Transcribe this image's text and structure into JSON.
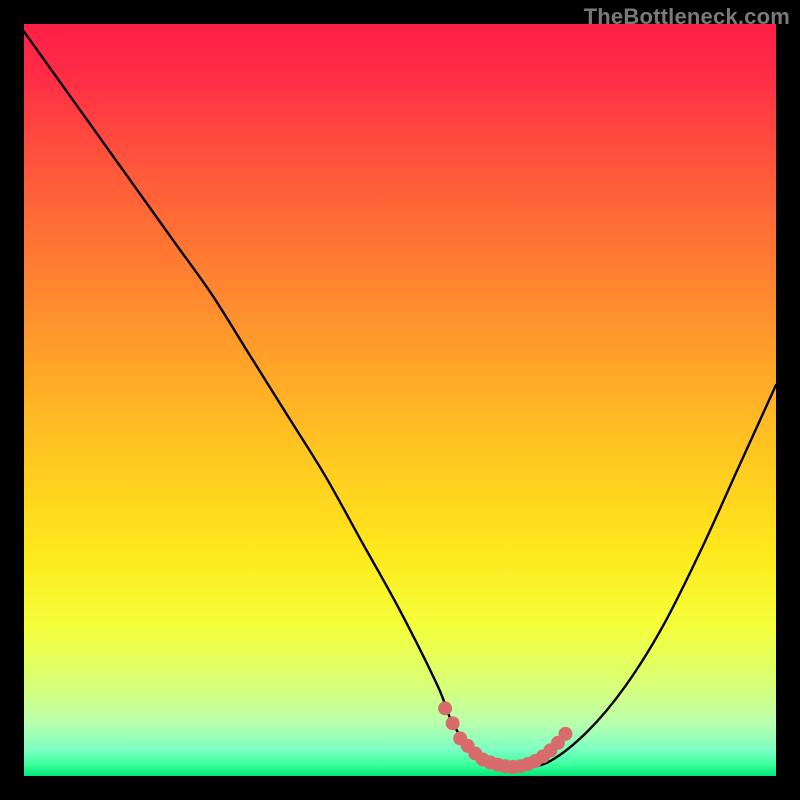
{
  "watermark": {
    "text": "TheBottleneck.com"
  },
  "chart_data": {
    "type": "line",
    "title": "",
    "xlabel": "",
    "ylabel": "",
    "xlim": [
      0,
      100
    ],
    "ylim": [
      0,
      100
    ],
    "background_gradient": {
      "stops": [
        {
          "pos": 0.0,
          "color": "#ff1f44"
        },
        {
          "pos": 0.06,
          "color": "#ff2a47"
        },
        {
          "pos": 0.2,
          "color": "#ff5a3a"
        },
        {
          "pos": 0.38,
          "color": "#ff8e2e"
        },
        {
          "pos": 0.55,
          "color": "#ffc122"
        },
        {
          "pos": 0.7,
          "color": "#ffe81c"
        },
        {
          "pos": 0.8,
          "color": "#f5ff3a"
        },
        {
          "pos": 0.88,
          "color": "#d8ff78"
        },
        {
          "pos": 0.93,
          "color": "#b8ffae"
        },
        {
          "pos": 0.965,
          "color": "#7dffc3"
        },
        {
          "pos": 0.985,
          "color": "#3bff9e"
        },
        {
          "pos": 1.0,
          "color": "#00e874"
        }
      ]
    },
    "series": [
      {
        "name": "bottleneck-curve",
        "x": [
          0,
          5,
          10,
          15,
          20,
          25,
          30,
          35,
          40,
          45,
          50,
          55,
          57,
          60,
          63,
          66,
          70,
          75,
          80,
          85,
          90,
          95,
          100
        ],
        "y": [
          99,
          92,
          85,
          78,
          71,
          64,
          56,
          48,
          40,
          31,
          22,
          12,
          7,
          3,
          1,
          1,
          2,
          6,
          12,
          20,
          30,
          41,
          52
        ]
      }
    ],
    "markers": {
      "name": "optimal-band",
      "color": "#d86b6b",
      "points": [
        {
          "x": 56,
          "y": 9
        },
        {
          "x": 57,
          "y": 7
        },
        {
          "x": 58,
          "y": 5
        },
        {
          "x": 59,
          "y": 4
        },
        {
          "x": 60,
          "y": 3
        },
        {
          "x": 61,
          "y": 2.2
        },
        {
          "x": 62,
          "y": 1.8
        },
        {
          "x": 63,
          "y": 1.5
        },
        {
          "x": 64,
          "y": 1.3
        },
        {
          "x": 65,
          "y": 1.2
        },
        {
          "x": 66,
          "y": 1.3
        },
        {
          "x": 67,
          "y": 1.6
        },
        {
          "x": 68,
          "y": 2.0
        },
        {
          "x": 69,
          "y": 2.6
        },
        {
          "x": 70,
          "y": 3.4
        },
        {
          "x": 71,
          "y": 4.4
        },
        {
          "x": 72,
          "y": 5.6
        }
      ]
    }
  }
}
